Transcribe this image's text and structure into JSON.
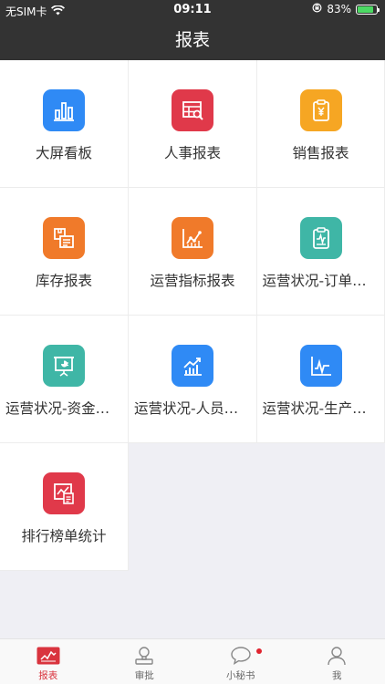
{
  "status_bar": {
    "carrier": "无SIM卡",
    "time": "09:11",
    "battery_percent": "83%",
    "battery_level": 0.83
  },
  "header": {
    "title": "报表"
  },
  "reports": [
    {
      "label": "大屏看板",
      "icon": "bar-chart-icon",
      "color": "#2f8af5"
    },
    {
      "label": "人事报表",
      "icon": "table-search-icon",
      "color": "#e0394a"
    },
    {
      "label": "销售报表",
      "icon": "clipboard-yen-icon",
      "color": "#f6a623"
    },
    {
      "label": "库存报表",
      "icon": "inventory-icon",
      "color": "#f07a2a"
    },
    {
      "label": "运营指标报表",
      "icon": "line-chart-icon",
      "color": "#f07a2a"
    },
    {
      "label": "运营状况-订单状况",
      "icon": "clipboard-chart-icon",
      "color": "#3fb6a6"
    },
    {
      "label": "运营状况-资金状况",
      "icon": "presentation-icon",
      "color": "#3fb6a6"
    },
    {
      "label": "运营状况-人员状况",
      "icon": "trend-up-icon",
      "color": "#2f8af5"
    },
    {
      "label": "运营状况-生产状况",
      "icon": "pulse-chart-icon",
      "color": "#2f8af5"
    },
    {
      "label": "排行榜单统计",
      "icon": "ranking-icon",
      "color": "#e0394a"
    }
  ],
  "tabbar": {
    "items": [
      {
        "label": "报表",
        "icon": "report-chart-icon",
        "active": true
      },
      {
        "label": "审批",
        "icon": "person-stamp-icon",
        "active": false
      },
      {
        "label": "小秘书",
        "icon": "chat-bubble-icon",
        "active": false,
        "badge": true
      },
      {
        "label": "我",
        "icon": "user-icon",
        "active": false
      }
    ],
    "active_color": "#d9343e"
  }
}
